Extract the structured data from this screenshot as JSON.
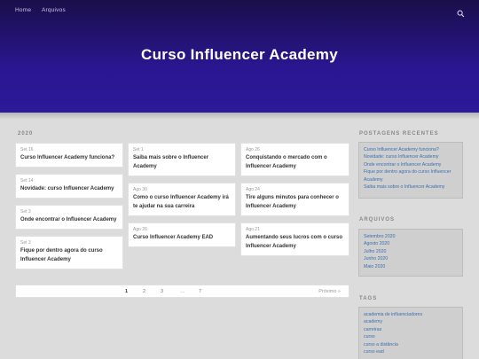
{
  "nav": {
    "home": "Home",
    "archives": "Arquivos"
  },
  "site": {
    "title": "Curso Influencer Academy"
  },
  "main": {
    "year_label": "2020",
    "columns": [
      [
        {
          "date": "Set 16",
          "title": "Curso Influencer Academy funciona?"
        },
        {
          "date": "Set 14",
          "title": "Novidade: curso Influencer Academy"
        },
        {
          "date": "Set 3",
          "title": "Onde encontrar o Influencer Academy"
        },
        {
          "date": "Set 3",
          "title": "Fique por dentro agora do curso Influencer Academy"
        }
      ],
      [
        {
          "date": "Set 1",
          "title": "Saiba mais sobre o Influencer Academy"
        },
        {
          "date": "Ago 30",
          "title": "Como o curso Influencer Academy irá te ajudar na sua carreira"
        },
        {
          "date": "Ago 26",
          "title": "Curso Influencer Academy EAD"
        }
      ],
      [
        {
          "date": "Ago 26",
          "title": "Conquistando o mercado com o Influencer Academy"
        },
        {
          "date": "Ago 24",
          "title": "Tire alguns minutos para conhecer o Influencer Academy"
        },
        {
          "date": "Ago 21",
          "title": "Aumentando seus lucros com o curso Influencer Academy"
        }
      ]
    ]
  },
  "pagination": {
    "pages": [
      "1",
      "2",
      "3",
      "…",
      "7"
    ],
    "current": "1",
    "next": "Próximo »"
  },
  "sidebar": {
    "recent_heading": "POSTAGENS RECENTES",
    "recent": [
      "Curso Influencer Academy funciona?",
      "Novidade: curso Influencer Academy",
      "Onde encontrar o Influencer Academy",
      "Fique por dentro agora do curso Influencer",
      "Academy",
      "Saiba mais sobre o Influencer Academy"
    ],
    "archive_heading": "ARQUIVOS",
    "archives": [
      "Setembro 2020",
      "Agosto 2020",
      "Julho 2020",
      "Junho 2020",
      "Maio 2020"
    ],
    "tags_heading": "TAGS",
    "tags": [
      "academia de influenciadores",
      "academy",
      "carreiras",
      "curso",
      "curso a distância",
      "curso ead"
    ]
  },
  "icons": {
    "search": "search-icon"
  },
  "colors": {
    "hero_top": "#1a0f4a",
    "hero_bottom": "#2c1999",
    "link": "#3b6fb0",
    "background": "#dcdcdc"
  }
}
